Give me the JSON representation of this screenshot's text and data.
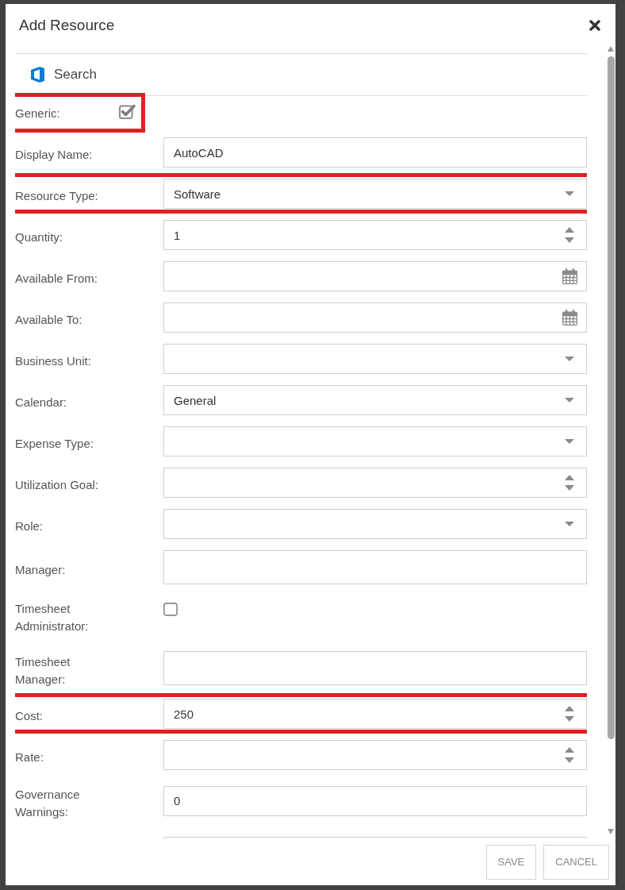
{
  "dialog": {
    "title": "Add Resource"
  },
  "search": {
    "label": "Search"
  },
  "generic": {
    "label": "Generic:",
    "checked": true,
    "highlighted": true
  },
  "rows": [
    {
      "label": "Display Name:",
      "kind": "text",
      "value": "AutoCAD",
      "highlighted": false,
      "cut_off": false
    },
    {
      "label": "Resource Type:",
      "kind": "select",
      "value": "Software",
      "highlighted": true,
      "cut_off": false
    },
    {
      "label": "Quantity:",
      "kind": "number",
      "value": "1",
      "highlighted": false,
      "cut_off": false
    },
    {
      "label": "Available From:",
      "kind": "date",
      "highlighted": false,
      "cut_off": false
    },
    {
      "label": "Available To:",
      "kind": "date",
      "highlighted": false,
      "cut_off": false
    },
    {
      "label": "Business Unit:",
      "kind": "select",
      "highlighted": false,
      "cut_off": false
    },
    {
      "label": "Calendar:",
      "kind": "select",
      "value": "General",
      "highlighted": false,
      "cut_off": false
    },
    {
      "label": "Expense Type:",
      "kind": "select",
      "highlighted": false,
      "cut_off": false
    },
    {
      "label": "Utilization Goal:",
      "kind": "number",
      "highlighted": false,
      "cut_off": false
    },
    {
      "label": "Role:",
      "kind": "select",
      "highlighted": false,
      "cut_off": false
    },
    {
      "label": "Manager:",
      "kind": "person",
      "highlighted": false,
      "cut_off": false
    },
    {
      "label": "Timesheet Administrator:",
      "kind": "checkbox",
      "checked": false,
      "highlighted": false,
      "cut_off": false
    },
    {
      "label": "Timesheet Manager:",
      "kind": "person",
      "highlighted": false,
      "cut_off": false
    },
    {
      "label": "Cost:",
      "kind": "number",
      "value": "250",
      "highlighted": true,
      "cut_off": false
    },
    {
      "label": "Rate:",
      "kind": "number",
      "highlighted": false,
      "cut_off": false
    },
    {
      "label": "Governance Warnings:",
      "kind": "text",
      "value": "0",
      "highlighted": false,
      "cut_off": false
    },
    {
      "kind": "text",
      "highlighted": false,
      "cut_off": true
    }
  ],
  "footer": {
    "buttons": [
      "SAVE",
      "CANCEL"
    ]
  }
}
